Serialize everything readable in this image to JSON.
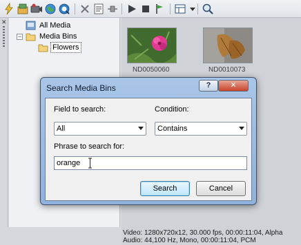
{
  "toolbar": {
    "items": [
      {
        "icon": "auto-preview-icon"
      },
      {
        "icon": "import-media-icon"
      },
      {
        "icon": "capture-video-icon"
      },
      {
        "icon": "get-media-web-icon"
      },
      {
        "icon": "media-fx-icon"
      },
      {
        "icon": "remove-icon"
      },
      {
        "icon": "properties-icon"
      },
      {
        "icon": "fx-plugin-icon"
      },
      {
        "icon": "play-icon"
      },
      {
        "icon": "stop-icon"
      },
      {
        "icon": "auto-preview-flag-icon"
      },
      {
        "icon": "views-icon"
      },
      {
        "icon": "views-dropdown-icon"
      },
      {
        "icon": "search-icon"
      }
    ]
  },
  "grip": {
    "close_glyph": "✕"
  },
  "tree": {
    "items": [
      {
        "label": "All Media",
        "icon": "all-media-icon"
      },
      {
        "label": "Media Bins",
        "icon": "folder-icon",
        "expander": "−"
      },
      {
        "label": "Flowers",
        "icon": "folder-icon",
        "selected": true
      }
    ]
  },
  "media": {
    "thumbnails": [
      {
        "caption": "ND0050060",
        "icon": "flower-thumbnail"
      },
      {
        "caption": "ND0010073",
        "icon": "leaves-thumbnail"
      }
    ]
  },
  "status": {
    "video": "Video: 1280x720x12, 30.000 fps, 00:00:11:04, Alpha",
    "audio": "Audio: 44,100 Hz, Mono, 00:00:11:04, PCM"
  },
  "dialog": {
    "title": "Search Media Bins",
    "help_button": "?",
    "close_button": "✕",
    "field_label": "Field to search:",
    "field_value": "All",
    "condition_label": "Condition:",
    "condition_value": "Contains",
    "phrase_label": "Phrase to search for:",
    "phrase_value": "orange",
    "search_button": "Search",
    "cancel_button": "Cancel"
  }
}
